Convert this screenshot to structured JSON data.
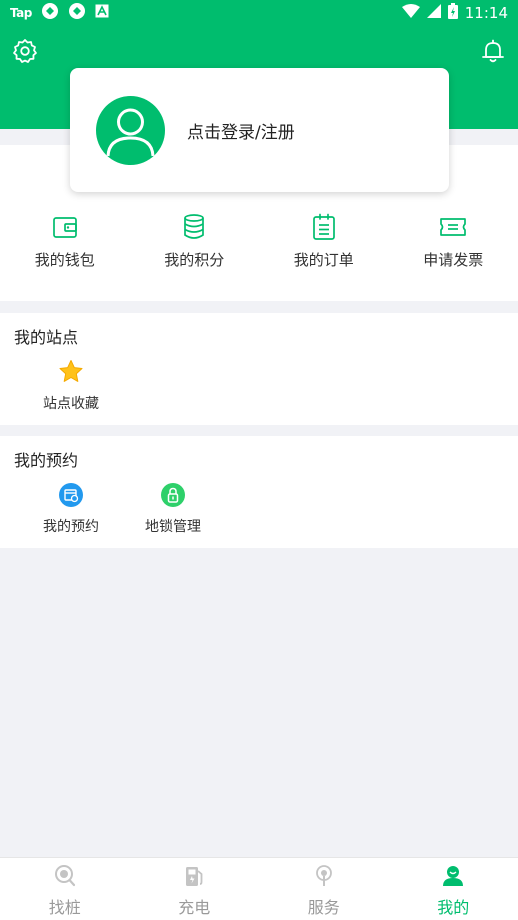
{
  "status_bar": {
    "carrier_text": "Tap",
    "time": "11:14"
  },
  "login": {
    "prompt": "点击登录/注册"
  },
  "quick_actions": [
    {
      "label": "我的钱包",
      "icon": "wallet-icon"
    },
    {
      "label": "我的积分",
      "icon": "coins-stack-icon"
    },
    {
      "label": "我的订单",
      "icon": "order-list-icon"
    },
    {
      "label": "申请发票",
      "icon": "ticket-icon"
    }
  ],
  "my_stations": {
    "title": "我的站点",
    "items": [
      {
        "label": "站点收藏",
        "icon": "star-icon"
      }
    ]
  },
  "my_reservations": {
    "title": "我的预约",
    "items": [
      {
        "label": "我的预约",
        "icon": "calendar-clock-icon"
      },
      {
        "label": "地锁管理",
        "icon": "lock-icon"
      }
    ]
  },
  "tab_bar": {
    "active_index": 3,
    "tabs": [
      {
        "label": "找桩",
        "icon": "search-pin-icon"
      },
      {
        "label": "充电",
        "icon": "fuel-pump-icon"
      },
      {
        "label": "服务",
        "icon": "signal-pin-icon"
      },
      {
        "label": "我的",
        "icon": "person-icon"
      }
    ]
  },
  "colors": {
    "brand_green": "#00bd6e",
    "background": "#f1f2f6",
    "inactive_tab": "#9a9a9a"
  }
}
